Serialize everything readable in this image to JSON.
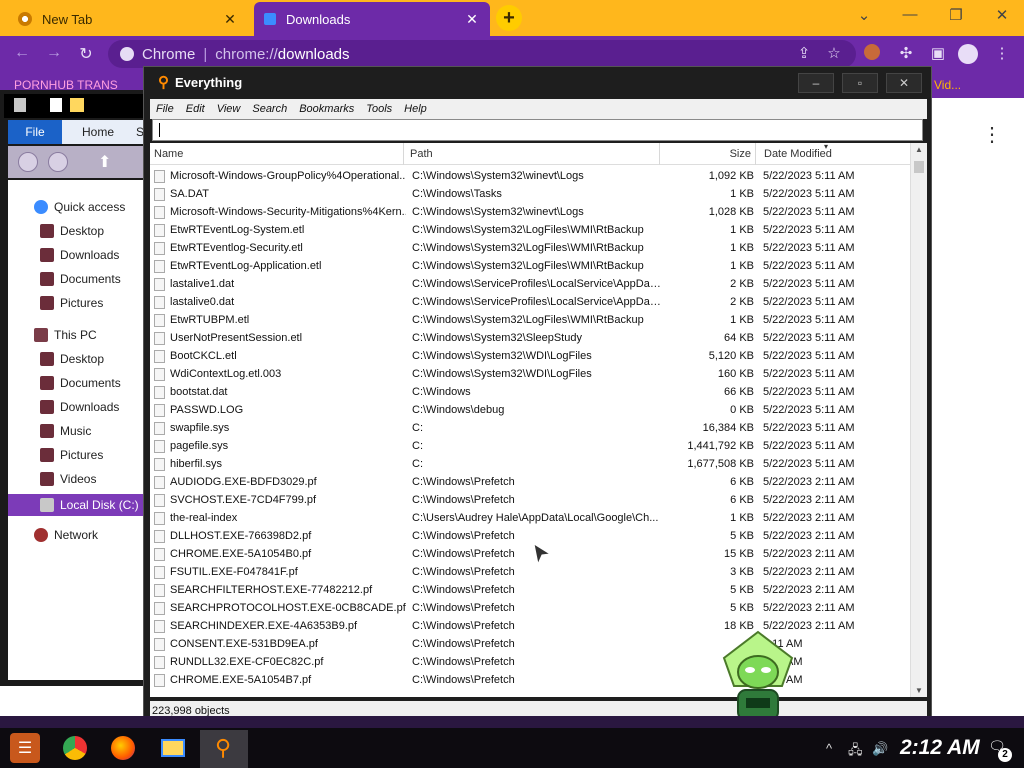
{
  "browser": {
    "tabs": [
      {
        "title": "New Tab",
        "active": false
      },
      {
        "title": "Downloads",
        "active": true
      }
    ],
    "new_tab_label": "+",
    "omnibox": {
      "site_label": "Chrome",
      "url_scheme": "chrome://",
      "url_path": "downloads"
    },
    "bookmarks": {
      "left": "PORNHUB TRANS",
      "right": "Vid..."
    },
    "menu_glyph": "⋮"
  },
  "explorer": {
    "ribbon": {
      "file": "File",
      "home": "Home",
      "share": "S"
    },
    "nav": [
      {
        "label": "Quick access",
        "icon": "star-icon"
      },
      {
        "label": "Desktop",
        "icon": "desktop-icon"
      },
      {
        "label": "Downloads",
        "icon": "downloads-icon"
      },
      {
        "label": "Documents",
        "icon": "documents-icon"
      },
      {
        "label": "Pictures",
        "icon": "pictures-icon"
      },
      {
        "label": "This PC",
        "icon": "pc-icon"
      },
      {
        "label": "Desktop",
        "icon": "desktop-icon"
      },
      {
        "label": "Documents",
        "icon": "documents-icon"
      },
      {
        "label": "Downloads",
        "icon": "downloads-icon"
      },
      {
        "label": "Music",
        "icon": "music-icon"
      },
      {
        "label": "Pictures",
        "icon": "pictures-icon"
      },
      {
        "label": "Videos",
        "icon": "videos-icon"
      },
      {
        "label": "Local Disk (C:)",
        "icon": "disk-icon",
        "selected": true
      },
      {
        "label": "Network",
        "icon": "network-icon"
      }
    ]
  },
  "everything": {
    "title": "Everything",
    "window_buttons": {
      "minimize": "–",
      "maximize": "▫",
      "close": "✕"
    },
    "menu": [
      "File",
      "Edit",
      "View",
      "Search",
      "Bookmarks",
      "Tools",
      "Help"
    ],
    "search_value": "",
    "columns": {
      "name": "Name",
      "path": "Path",
      "size": "Size",
      "date": "Date Modified"
    },
    "rows": [
      {
        "name": "Microsoft-Windows-GroupPolicy%4Operational...",
        "path": "C:\\Windows\\System32\\winevt\\Logs",
        "size": "1,092 KB",
        "date": "5/22/2023 5:11 AM"
      },
      {
        "name": "SA.DAT",
        "path": "C:\\Windows\\Tasks",
        "size": "1 KB",
        "date": "5/22/2023 5:11 AM"
      },
      {
        "name": "Microsoft-Windows-Security-Mitigations%4Kern...",
        "path": "C:\\Windows\\System32\\winevt\\Logs",
        "size": "1,028 KB",
        "date": "5/22/2023 5:11 AM"
      },
      {
        "name": "EtwRTEventLog-System.etl",
        "path": "C:\\Windows\\System32\\LogFiles\\WMI\\RtBackup",
        "size": "1 KB",
        "date": "5/22/2023 5:11 AM"
      },
      {
        "name": "EtwRTEventlog-Security.etl",
        "path": "C:\\Windows\\System32\\LogFiles\\WMI\\RtBackup",
        "size": "1 KB",
        "date": "5/22/2023 5:11 AM"
      },
      {
        "name": "EtwRTEventLog-Application.etl",
        "path": "C:\\Windows\\System32\\LogFiles\\WMI\\RtBackup",
        "size": "1 KB",
        "date": "5/22/2023 5:11 AM"
      },
      {
        "name": "lastalive1.dat",
        "path": "C:\\Windows\\ServiceProfiles\\LocalService\\AppDat...",
        "size": "2 KB",
        "date": "5/22/2023 5:11 AM"
      },
      {
        "name": "lastalive0.dat",
        "path": "C:\\Windows\\ServiceProfiles\\LocalService\\AppDat...",
        "size": "2 KB",
        "date": "5/22/2023 5:11 AM"
      },
      {
        "name": "EtwRTUBPM.etl",
        "path": "C:\\Windows\\System32\\LogFiles\\WMI\\RtBackup",
        "size": "1 KB",
        "date": "5/22/2023 5:11 AM"
      },
      {
        "name": "UserNotPresentSession.etl",
        "path": "C:\\Windows\\System32\\SleepStudy",
        "size": "64 KB",
        "date": "5/22/2023 5:11 AM"
      },
      {
        "name": "BootCKCL.etl",
        "path": "C:\\Windows\\System32\\WDI\\LogFiles",
        "size": "5,120 KB",
        "date": "5/22/2023 5:11 AM"
      },
      {
        "name": "WdiContextLog.etl.003",
        "path": "C:\\Windows\\System32\\WDI\\LogFiles",
        "size": "160 KB",
        "date": "5/22/2023 5:11 AM"
      },
      {
        "name": "bootstat.dat",
        "path": "C:\\Windows",
        "size": "66 KB",
        "date": "5/22/2023 5:11 AM"
      },
      {
        "name": "PASSWD.LOG",
        "path": "C:\\Windows\\debug",
        "size": "0 KB",
        "date": "5/22/2023 5:11 AM"
      },
      {
        "name": "swapfile.sys",
        "path": "C:",
        "size": "16,384 KB",
        "date": "5/22/2023 5:11 AM"
      },
      {
        "name": "pagefile.sys",
        "path": "C:",
        "size": "1,441,792 KB",
        "date": "5/22/2023 5:11 AM"
      },
      {
        "name": "hiberfil.sys",
        "path": "C:",
        "size": "1,677,508 KB",
        "date": "5/22/2023 5:11 AM"
      },
      {
        "name": "AUDIODG.EXE-BDFD3029.pf",
        "path": "C:\\Windows\\Prefetch",
        "size": "6 KB",
        "date": "5/22/2023 2:11 AM"
      },
      {
        "name": "SVCHOST.EXE-7CD4F799.pf",
        "path": "C:\\Windows\\Prefetch",
        "size": "6 KB",
        "date": "5/22/2023 2:11 AM"
      },
      {
        "name": "the-real-index",
        "path": "C:\\Users\\Audrey Hale\\AppData\\Local\\Google\\Ch...",
        "size": "1 KB",
        "date": "5/22/2023 2:11 AM"
      },
      {
        "name": "DLLHOST.EXE-766398D2.pf",
        "path": "C:\\Windows\\Prefetch",
        "size": "5 KB",
        "date": "5/22/2023 2:11 AM"
      },
      {
        "name": "CHROME.EXE-5A1054B0.pf",
        "path": "C:\\Windows\\Prefetch",
        "size": "15 KB",
        "date": "5/22/2023 2:11 AM"
      },
      {
        "name": "FSUTIL.EXE-F047841F.pf",
        "path": "C:\\Windows\\Prefetch",
        "size": "3 KB",
        "date": "5/22/2023 2:11 AM"
      },
      {
        "name": "SEARCHFILTERHOST.EXE-77482212.pf",
        "path": "C:\\Windows\\Prefetch",
        "size": "5 KB",
        "date": "5/22/2023 2:11 AM"
      },
      {
        "name": "SEARCHPROTOCOLHOST.EXE-0CB8CADE.pf",
        "path": "C:\\Windows\\Prefetch",
        "size": "5 KB",
        "date": "5/22/2023 2:11 AM"
      },
      {
        "name": "SEARCHINDEXER.EXE-4A6353B9.pf",
        "path": "C:\\Windows\\Prefetch",
        "size": "18 KB",
        "date": "5/22/2023 2:11 AM"
      },
      {
        "name": "CONSENT.EXE-531BD9EA.pf",
        "path": "C:\\Windows\\Prefetch",
        "size": "",
        "date": "2:11 AM"
      },
      {
        "name": "RUNDLL32.EXE-CF0EC82C.pf",
        "path": "C:\\Windows\\Prefetch",
        "size": "",
        "date": "2:11 AM"
      },
      {
        "name": "CHROME.EXE-5A1054B7.pf",
        "path": "C:\\Windows\\Prefetch",
        "size": "",
        "date": "2:11 AM"
      }
    ],
    "status": "223,998 objects"
  },
  "taskbar": {
    "clock": "2:12 AM",
    "notification_count": "2",
    "apps": [
      "start-icon",
      "chrome-icon",
      "firefox-icon",
      "file-explorer-icon",
      "everything-icon"
    ]
  },
  "colors": {
    "accent_purple": "#6d2aa8",
    "tab_yellow": "#ffb71c",
    "everything_orange": "#ff8a00"
  }
}
